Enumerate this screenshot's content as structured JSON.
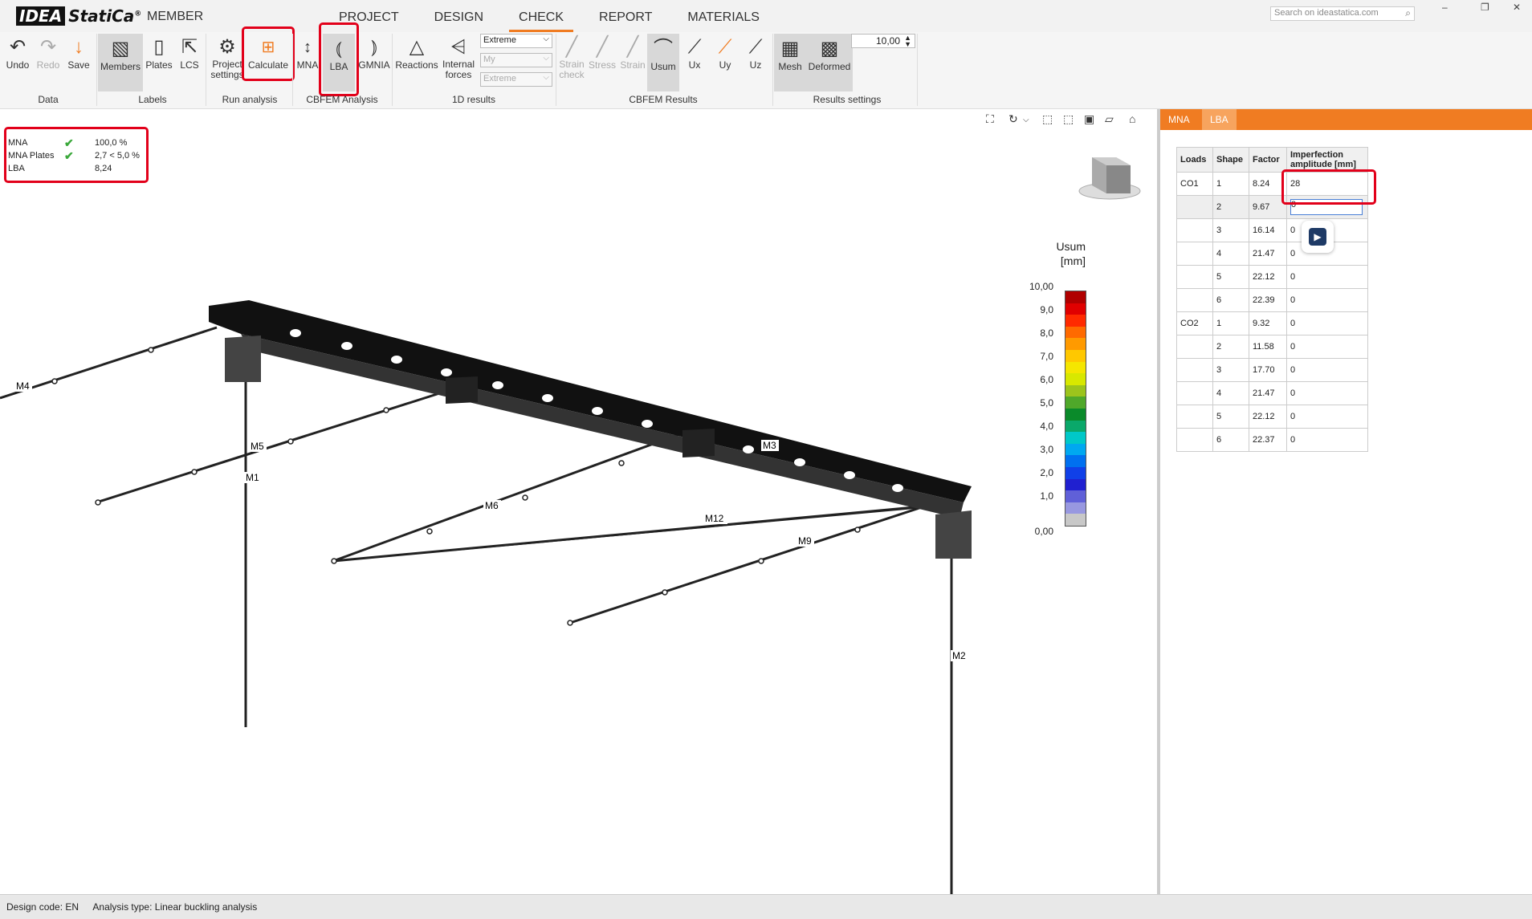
{
  "app": {
    "logo": "IDEA StatiCa",
    "trademark": "®",
    "name": "MEMBER"
  },
  "menu_tabs": [
    {
      "label": "PROJECT"
    },
    {
      "label": "DESIGN"
    },
    {
      "label": "CHECK",
      "active": true
    },
    {
      "label": "REPORT"
    },
    {
      "label": "MATERIALS"
    }
  ],
  "search": {
    "placeholder": "Search on ideastatica.com"
  },
  "ribbon": {
    "data": {
      "group": "Data",
      "undo": "Undo",
      "redo": "Redo",
      "save": "Save"
    },
    "labels": {
      "group": "Labels",
      "members": "Members",
      "plates": "Plates",
      "lcs": "LCS"
    },
    "run": {
      "group": "Run analysis",
      "project_settings_1": "Project",
      "project_settings_2": "settings",
      "calculate": "Calculate"
    },
    "cbfem": {
      "group": "CBFEM Analysis",
      "mna": "MNA",
      "lba": "LBA",
      "gmnia": "GMNIA"
    },
    "results1d": {
      "group": "1D results",
      "reactions": "Reactions",
      "internal_forces_1": "Internal",
      "internal_forces_2": "forces",
      "dd1": "Extreme",
      "dd2": "My",
      "dd3": "Extreme"
    },
    "cbfem_results": {
      "group": "CBFEM Results",
      "strain_check_1": "Strain",
      "strain_check_2": "check",
      "stress": "Stress",
      "strain": "Strain",
      "usum": "Usum",
      "ux": "Ux",
      "uy": "Uy",
      "uz": "Uz"
    },
    "results_settings": {
      "group": "Results settings",
      "mesh": "Mesh",
      "deformed": "Deformed",
      "scale_value": "10,00"
    }
  },
  "summary": [
    {
      "label": "MNA",
      "check": true,
      "value": "100,0 %"
    },
    {
      "label": "MNA Plates",
      "check": true,
      "value": "2,7 < 5,0 %"
    },
    {
      "label": "LBA",
      "check": false,
      "value": "8,24"
    }
  ],
  "legend": {
    "title_1": "Usum",
    "title_2": "[mm]",
    "labels": [
      "10,00",
      "9,0",
      "8,0",
      "7,0",
      "6,0",
      "5,0",
      "4,0",
      "3,0",
      "2,0",
      "1,0",
      "0,00"
    ],
    "colors": [
      "#b00000",
      "#e00000",
      "#ff2a00",
      "#ff6a00",
      "#ff9a00",
      "#ffc800",
      "#f5e600",
      "#d8e800",
      "#9cc41c",
      "#4fa82a",
      "#0a8a2a",
      "#0aa86a",
      "#00c8c8",
      "#00a8f0",
      "#0070f0",
      "#1040e8",
      "#2020d0",
      "#6060d8",
      "#9898e0",
      "#c8c8c8"
    ]
  },
  "members": [
    "M4",
    "M5",
    "M1",
    "M6",
    "M12",
    "M3",
    "M9",
    "M2"
  ],
  "panel": {
    "tabs": [
      {
        "label": "MNA"
      },
      {
        "label": "LBA",
        "active": true
      }
    ],
    "headers": [
      "Loads",
      "Shape",
      "Factor",
      "Imperfection amplitude [mm]"
    ],
    "rows": [
      {
        "load": "CO1",
        "shape": "1",
        "factor": "8.24",
        "amp": "28"
      },
      {
        "load": "",
        "shape": "2",
        "factor": "9.67",
        "amp": "0"
      },
      {
        "load": "",
        "shape": "3",
        "factor": "16.14",
        "amp": "0"
      },
      {
        "load": "",
        "shape": "4",
        "factor": "21.47",
        "amp": "0"
      },
      {
        "load": "",
        "shape": "5",
        "factor": "22.12",
        "amp": "0"
      },
      {
        "load": "",
        "shape": "6",
        "factor": "22.39",
        "amp": "0"
      },
      {
        "load": "CO2",
        "shape": "1",
        "factor": "9.32",
        "amp": "0"
      },
      {
        "load": "",
        "shape": "2",
        "factor": "11.58",
        "amp": "0"
      },
      {
        "load": "",
        "shape": "3",
        "factor": "17.70",
        "amp": "0"
      },
      {
        "load": "",
        "shape": "4",
        "factor": "21.47",
        "amp": "0"
      },
      {
        "load": "",
        "shape": "5",
        "factor": "22.12",
        "amp": "0"
      },
      {
        "load": "",
        "shape": "6",
        "factor": "22.37",
        "amp": "0"
      }
    ]
  },
  "status": {
    "design_code_label": "Design code:",
    "design_code": "EN",
    "analysis_label": "Analysis type:",
    "analysis": "Linear buckling analysis"
  },
  "colors": {
    "accent": "#f07c22",
    "highlight": "#e2001a",
    "check": "#3aa83a"
  }
}
